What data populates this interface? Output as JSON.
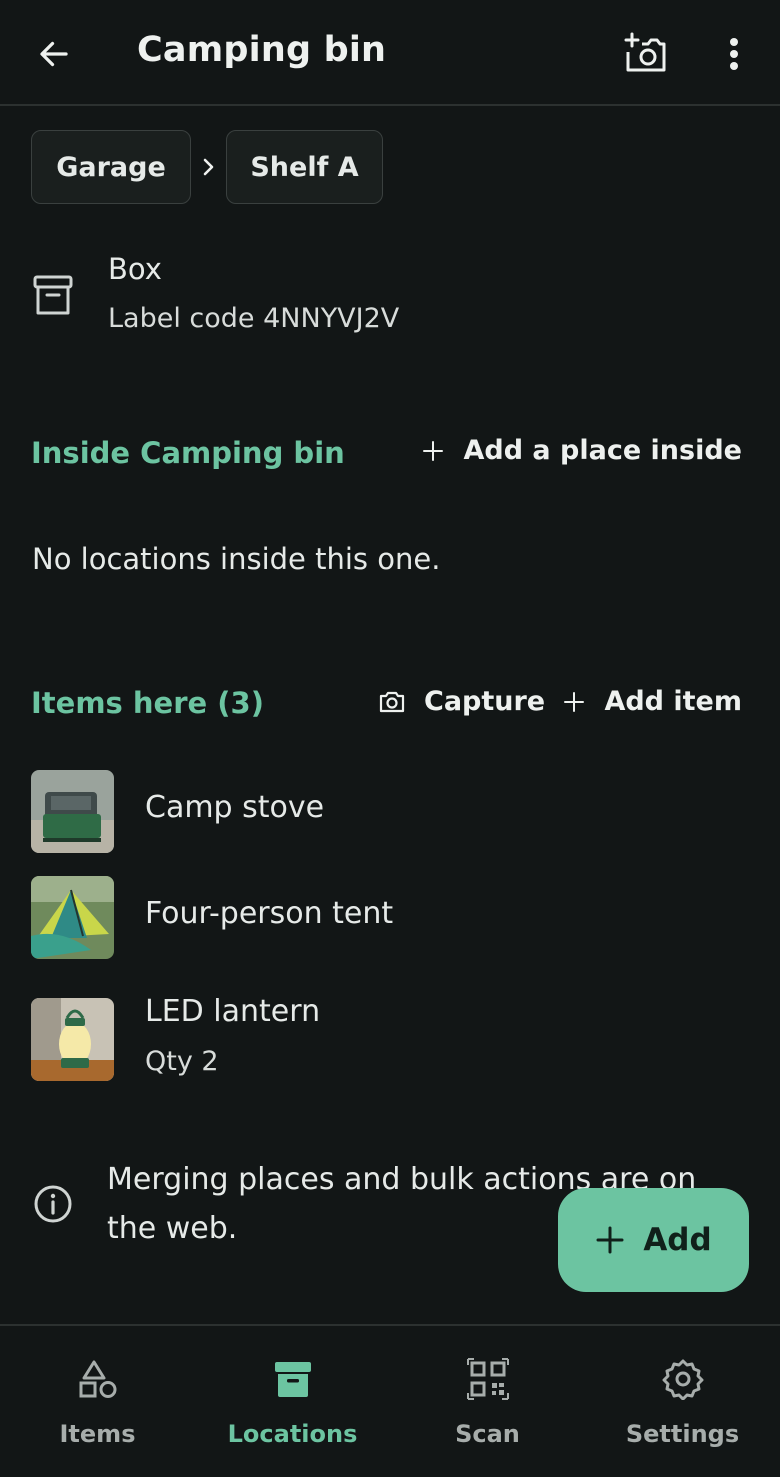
{
  "appbar": {
    "title": "Camping bin",
    "back_icon": "arrow-left-icon",
    "add_photo_icon": "camera-plus-icon",
    "more_icon": "more-vert-icon"
  },
  "breadcrumbs": [
    "Garage",
    "Shelf A"
  ],
  "details": {
    "kind": "Box",
    "label_code": "Label code 4NNYVJ2V"
  },
  "inside": {
    "title": "Inside Camping bin",
    "add_label": "Add a place inside",
    "empty_text": "No locations inside this one."
  },
  "items": {
    "title": "Items here (3)",
    "capture_label": "Capture",
    "add_label": "Add item",
    "list": [
      {
        "name": "Camp stove",
        "qty": ""
      },
      {
        "name": "Four-person tent",
        "qty": ""
      },
      {
        "name": "LED lantern",
        "qty": "Qty 2"
      }
    ]
  },
  "info": {
    "text": "Merging places and bulk actions are on the web."
  },
  "fab": {
    "label": "Add"
  },
  "nav": {
    "tabs": [
      {
        "label": "Items",
        "icon": "shapes-icon"
      },
      {
        "label": "Locations",
        "icon": "archive-box-icon"
      },
      {
        "label": "Scan",
        "icon": "qr-code-icon"
      },
      {
        "label": "Settings",
        "icon": "gear-icon"
      }
    ],
    "active": "Locations"
  },
  "colors": {
    "background": "#121616",
    "accent": "#6cc4a1",
    "text": "#e6eae8",
    "muted": "#a7adab"
  }
}
